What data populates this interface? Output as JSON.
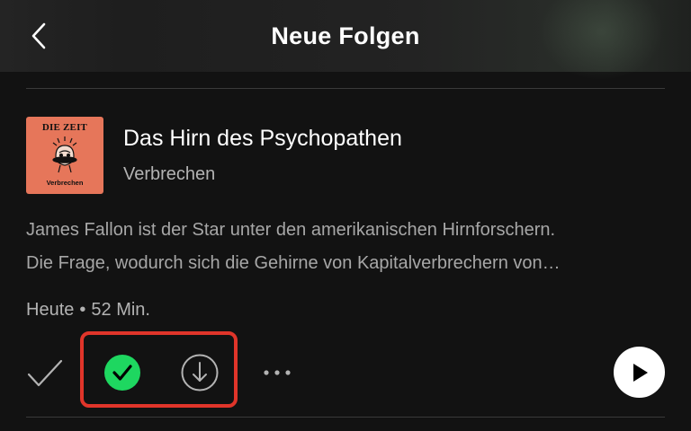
{
  "header": {
    "title": "Neue Folgen",
    "back_icon": "chevron-left-icon"
  },
  "episode": {
    "cover": {
      "brand": "DIE ZEIT",
      "show_name": "Verbrechen",
      "background_color": "#e6765a"
    },
    "title": "Das Hirn des Psychopathen",
    "show": "Verbrechen",
    "description_lines": [
      "James Fallon ist der Star unter den amerikanischen Hirnforschern.",
      "Die Frage, wodurch  sich die Gehirne von Kapitalverbrechern von…"
    ],
    "date": "Heute",
    "separator": "•",
    "duration": "52 Min."
  },
  "actions": {
    "mark_played_icon": "checkmark-icon",
    "added_icon": "added-check-circle-icon",
    "download_icon": "download-arrow-icon",
    "more_icon": "more-dots-icon",
    "play_icon": "play-icon",
    "highlight_color": "#e0352a",
    "accent_green": "#1ed760"
  }
}
